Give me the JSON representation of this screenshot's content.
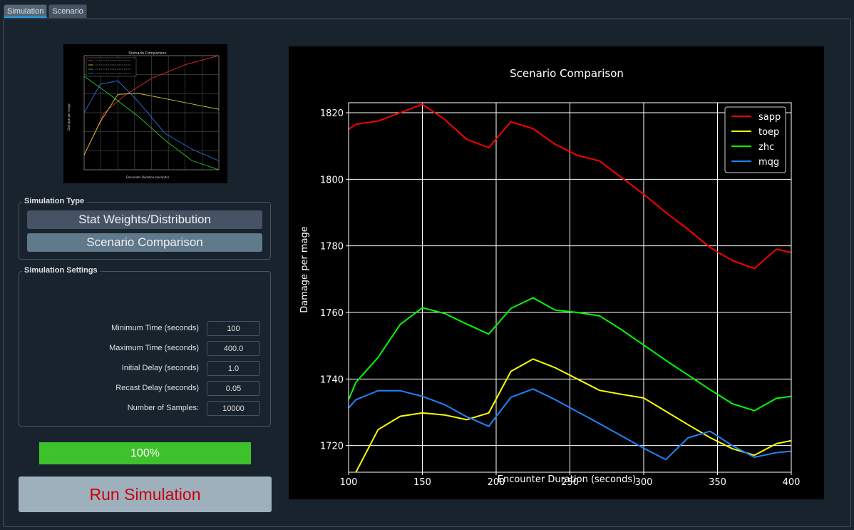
{
  "tabs": [
    {
      "label": "Simulation"
    },
    {
      "label": "Scenario"
    }
  ],
  "thumbnail": {
    "title": "Scenario Comparison",
    "xlabel": "Encounter Duration (seconds)",
    "ylabel": "Damage per mage"
  },
  "simulation_type": {
    "title": "Simulation Type",
    "stat_weights_label": "Stat Weights/Distribution",
    "scenario_comparison_label": "Scenario Comparison"
  },
  "simulation_settings": {
    "title": "Simulation Settings",
    "rows": [
      {
        "label": "Minimum Time (seconds)",
        "value": "100"
      },
      {
        "label": "Maximum Time (seconds)",
        "value": "400.0"
      },
      {
        "label": "Initial Delay (seconds)",
        "value": "1.0"
      },
      {
        "label": "Recast Delay (seconds)",
        "value": "0.05"
      },
      {
        "label": "Number of Samples:",
        "value": "10000"
      }
    ]
  },
  "progress": {
    "label": "100%",
    "value": 1.0
  },
  "run_button": {
    "label": "Run Simulation"
  },
  "colors": {
    "sapp": "#ff0000",
    "toep": "#ffff00",
    "zhc": "#00ff00",
    "mqg": "#1e82ff"
  },
  "chart_data": {
    "type": "line",
    "title": "Scenario Comparison",
    "xlabel": "Encounter Duration (seconds)",
    "ylabel": "Damage per mage",
    "xlim": [
      100,
      400
    ],
    "ylim": [
      1712,
      1823
    ],
    "xticks": [
      100,
      150,
      200,
      250,
      300,
      350,
      400
    ],
    "yticks": [
      1720,
      1740,
      1760,
      1780,
      1800,
      1820
    ],
    "grid": true,
    "legend": "top-right",
    "x": [
      100,
      105,
      120,
      135,
      150,
      165,
      180,
      195,
      210,
      225,
      240,
      255,
      270,
      285,
      300,
      315,
      330,
      345,
      360,
      375,
      390,
      400
    ],
    "series": [
      {
        "name": "sapp",
        "color": "#ff0000",
        "values": [
          1815,
          1816.5,
          1817.5,
          1820,
          1822.5,
          1818,
          1812,
          1809.5,
          1817.3,
          1815.2,
          1810.5,
          1807.2,
          1805.5,
          1800.5,
          1795.5,
          1790,
          1785,
          1779.5,
          1775.6,
          1773.2,
          1779,
          1778
        ]
      },
      {
        "name": "toep",
        "color": "#ffff00",
        "values": [
          1711,
          1712,
          1724.8,
          1728.8,
          1729.8,
          1729.2,
          1727.8,
          1729.8,
          1742.3,
          1746,
          1743.4,
          1740,
          1736.6,
          1735.4,
          1734.3,
          1730.3,
          1726.3,
          1722.4,
          1719.1,
          1717.1,
          1720.6,
          1721.5
        ]
      },
      {
        "name": "zhc",
        "color": "#00ff00",
        "values": [
          1733.8,
          1739,
          1746.5,
          1756.4,
          1761.4,
          1759.7,
          1756.5,
          1753.5,
          1761.2,
          1764.4,
          1760.7,
          1760,
          1759,
          1754.8,
          1750.2,
          1745.6,
          1741.2,
          1736.8,
          1732.6,
          1730.5,
          1734.2,
          1734.8
        ]
      },
      {
        "name": "mqg",
        "color": "#1e82ff",
        "values": [
          1731.3,
          1733.8,
          1736.5,
          1736.5,
          1734.8,
          1732.3,
          1728.7,
          1725.8,
          1734.5,
          1737,
          1733.8,
          1730.2,
          1726.6,
          1722.9,
          1719.2,
          1715.8,
          1722.3,
          1724.3,
          1720,
          1716.5,
          1717.9,
          1718.3
        ]
      }
    ]
  }
}
